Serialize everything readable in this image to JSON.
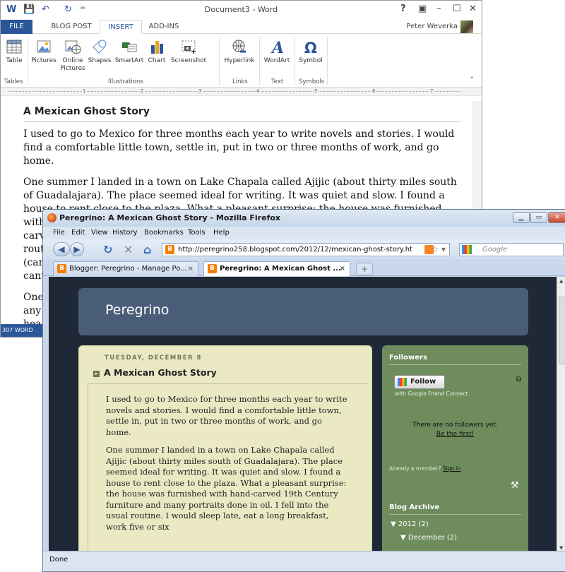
{
  "word": {
    "title": "Document3 - Word",
    "user": "Peter Weverka",
    "quick_access": [
      "W",
      "💾",
      "↶",
      "↻",
      "="
    ],
    "window_controls": [
      "?",
      "▣",
      "–",
      "☐",
      "✕"
    ],
    "tabs": [
      "FILE",
      "BLOG POST",
      "INSERT",
      "ADD-INS"
    ],
    "ribbon": {
      "table": "Table",
      "pictures": "Pictures",
      "online_pictures": "Online Pictures",
      "shapes": "Shapes",
      "smartart": "SmartArt",
      "chart": "Chart",
      "screenshot": "Screenshot",
      "hyperlink": "Hyperlink",
      "wordart": "WordArt",
      "symbol": "Symbol",
      "groups": [
        "Tables",
        "Illustrations",
        "Links",
        "Text",
        "Symbols"
      ]
    },
    "ruler_numbers": [
      "1",
      "2",
      "3",
      "4",
      "5",
      "6",
      "7"
    ],
    "doc_title": "A Mexican Ghost Story",
    "paragraphs": [
      "I used to go to Mexico for three months each year to write novels and stories. I would find a comfortable little town, settle in, put in two or three months of work, and go home.",
      "One summer I landed in a town on Lake Chapala called Ajijic (about thirty miles south of Guadalajara). The place seemed ideal for writing. It was quiet and slow. I found a house to rent close to the plaza. What a pleasant surprise: the house was furnished with hand-",
      "One"
    ],
    "hidden_fragments": [
      "carv",
      "rout",
      "(car",
      "cant",
      "any",
      "hea",
      "cant"
    ],
    "status": "307 WORD"
  },
  "firefox": {
    "title": "Peregrino: A Mexican Ghost Story - Mozilla Firefox",
    "menu": [
      "File",
      "Edit",
      "View",
      "History",
      "Bookmarks",
      "Tools",
      "Help"
    ],
    "url": "http://peregrino258.blogspot.com/2012/12/mexican-ghost-story.ht",
    "search_placeholder": "Google",
    "tabs": [
      "Blogger: Peregrino - Manage Po...",
      "Peregrino: A Mexican Ghost ..."
    ],
    "new_tab": "+",
    "status": "Done"
  },
  "blog": {
    "name": "Peregrino",
    "post_date": "TUESDAY, DECEMBER 8",
    "post_title": "A Mexican Ghost Story",
    "paragraphs": [
      "I used to go to Mexico for three months each year to write novels and stories. I would find a comfortable little town, settle in, put in two or three months of work, and go home.",
      "One summer I landed in a town on Lake Chapala called Ajijic (about thirty miles south of Guadalajara). The place seemed ideal for writing. It was quiet and slow. I found a house to rent close to the plaza. What a pleasant surprise: the house was furnished with hand-carved 19th Century furniture and many portraits done in oil. I fell into the usual routine. I would sleep late, eat a long breakfast, work five or six"
    ],
    "sidebar": {
      "followers_title": "Followers",
      "follow_button": "Follow",
      "gfc": "with Google Friend Connect",
      "no_followers": "There are no followers yet.",
      "be_first": "Be the first!",
      "already_member": "Already a member?",
      "sign_in": "Sign in",
      "archive_title": "Blog Archive",
      "year": "▼ 2012 (2)",
      "month": "▼ December (2)"
    }
  }
}
